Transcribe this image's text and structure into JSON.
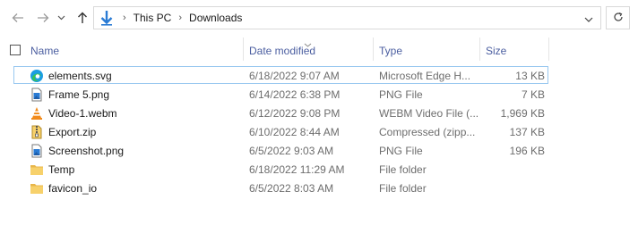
{
  "nav": {
    "back_icon": "arrow-left-icon",
    "forward_icon": "arrow-right-icon",
    "history_icon": "chevron-down-icon",
    "up_icon": "arrow-up-icon",
    "breadcrumbs": [
      "This PC",
      "Downloads"
    ],
    "refresh_icon": "refresh-icon"
  },
  "columns": {
    "name": "Name",
    "date": "Date modified",
    "type": "Type",
    "size": "Size"
  },
  "files": [
    {
      "name": "elements.svg",
      "date": "6/18/2022 9:07 AM",
      "type": "Microsoft Edge H...",
      "size": "13 KB",
      "icon": "edge-icon",
      "selected": true
    },
    {
      "name": "Frame 5.png",
      "date": "6/14/2022 6:38 PM",
      "type": "PNG File",
      "size": "7 KB",
      "icon": "image-file-icon"
    },
    {
      "name": "Video-1.webm",
      "date": "6/12/2022 9:08 PM",
      "type": "WEBM Video File (...",
      "size": "1,969 KB",
      "icon": "vlc-icon"
    },
    {
      "name": "Export.zip",
      "date": "6/10/2022 8:44 AM",
      "type": "Compressed (zipp...",
      "size": "137 KB",
      "icon": "zip-icon"
    },
    {
      "name": "Screenshot.png",
      "date": "6/5/2022 9:03 AM",
      "type": "PNG File",
      "size": "196 KB",
      "icon": "image-file-icon"
    },
    {
      "name": "Temp",
      "date": "6/18/2022 11:29 AM",
      "type": "File folder",
      "size": "",
      "icon": "folder-icon"
    },
    {
      "name": "favicon_io",
      "date": "6/5/2022 8:03 AM",
      "type": "File folder",
      "size": "",
      "icon": "folder-icon"
    }
  ],
  "colors": {
    "header_text": "#4b5ea0",
    "selection_border": "#99c8f0",
    "accent_blue": "#2a7bd4",
    "folder": "#f7d16b"
  }
}
